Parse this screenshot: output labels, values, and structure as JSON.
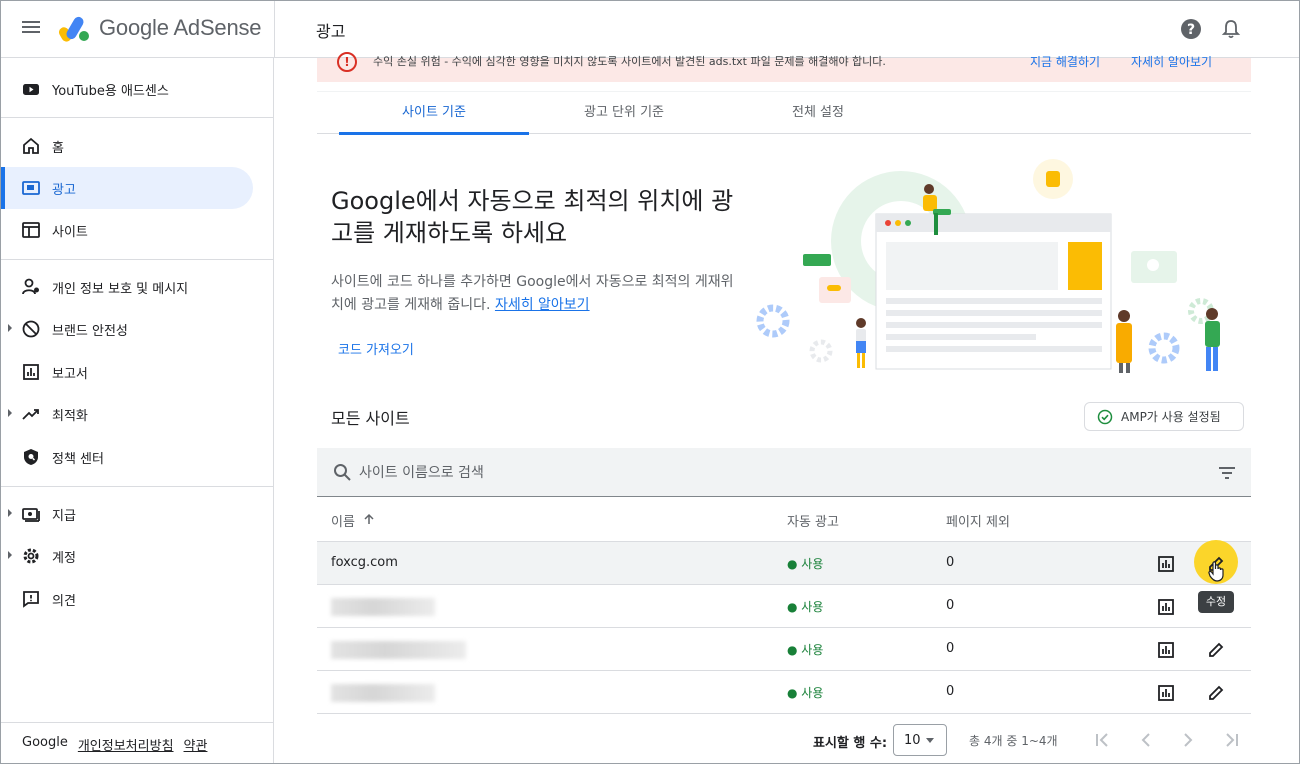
{
  "header": {
    "brand": "Google AdSense",
    "page_title": "광고"
  },
  "sidebar": {
    "youtube": "YouTube용 애드센스",
    "items": [
      {
        "label": "홈"
      },
      {
        "label": "광고"
      },
      {
        "label": "사이트"
      },
      {
        "label": "개인 정보 보호 및 메시지"
      },
      {
        "label": "브랜드 안전성"
      },
      {
        "label": "보고서"
      },
      {
        "label": "최적화"
      },
      {
        "label": "정책 센터"
      },
      {
        "label": "지급"
      },
      {
        "label": "계정"
      },
      {
        "label": "의견"
      }
    ],
    "footer": {
      "google": "Google",
      "privacy": "개인정보처리방침",
      "terms": "약관"
    }
  },
  "alert": {
    "text": "수익 손실 위험 - 수익에 심각한 영향을 미치지 않도록 사이트에서 발견된 ads.txt 파일 문제를 해결해야 합니다.",
    "fix": "지금 해결하기",
    "learn": "자세히 알아보기"
  },
  "tabs": [
    "사이트 기준",
    "광고 단위 기준",
    "전체 설정"
  ],
  "hero": {
    "title": "Google에서 자동으로 최적의 위치에 광고를 게재하도록 하세요",
    "desc": "사이트에 코드 하나를 추가하면 Google에서 자동으로 최적의 게재위치에 광고를 게재해 줍니다.",
    "link": "자세히 알아보기",
    "get_code": "코드 가져오기"
  },
  "sites": {
    "heading": "모든 사이트",
    "amp": "AMP가 사용 설정됨",
    "search_placeholder": "사이트 이름으로 검색",
    "columns": {
      "name": "이름",
      "auto_ads": "자동 광고",
      "page_exclusion": "페이지 제외"
    },
    "rows": [
      {
        "name": "foxcg.com",
        "status": "● 사용",
        "excluded": "0"
      },
      {
        "name": "",
        "status": "● 사용",
        "excluded": "0"
      },
      {
        "name": "",
        "status": "● 사용",
        "excluded": "0"
      },
      {
        "name": "",
        "status": "● 사용",
        "excluded": "0"
      }
    ],
    "tooltip": "수정"
  },
  "pagination": {
    "label": "표시할 행 수:",
    "rows_per_page": "10",
    "range": "총 4개 중 1~4개"
  },
  "colors": {
    "accent": "#1a73e8",
    "active_bg": "#e8f0fe",
    "status_green": "#188038",
    "alert_bg": "#fce8e6",
    "alert_red": "#d93025",
    "highlight": "#fbd52a"
  }
}
